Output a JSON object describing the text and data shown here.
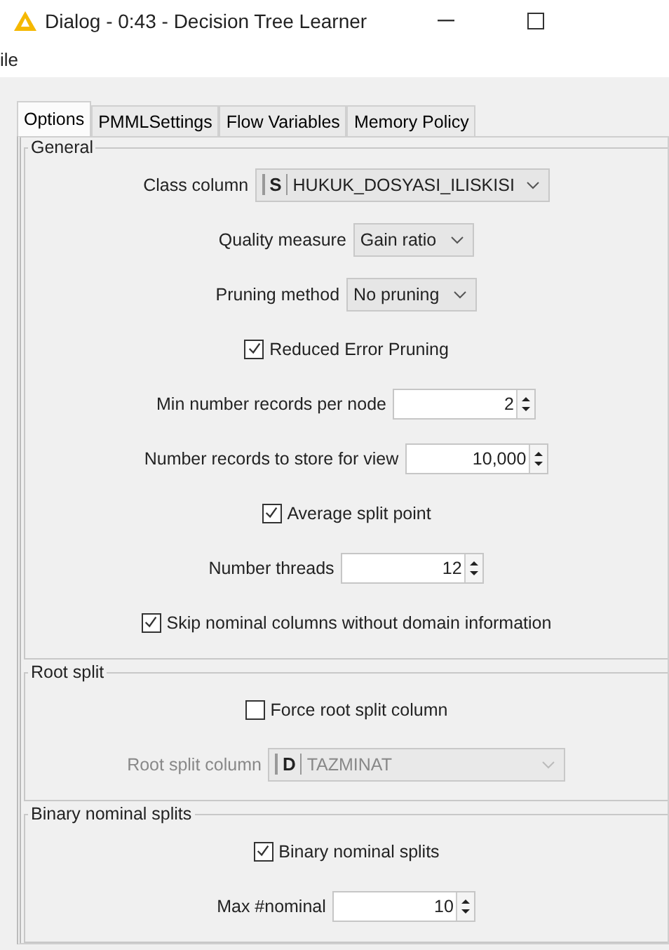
{
  "window": {
    "title": "Dialog - 0:43 - Decision Tree Learner"
  },
  "menu": [
    "ile"
  ],
  "tabs": [
    {
      "label": "Options",
      "selected": true
    },
    {
      "label": "PMMLSettings",
      "selected": false
    },
    {
      "label": "Flow Variables",
      "selected": false
    },
    {
      "label": "Memory Policy",
      "selected": false
    }
  ],
  "sections": [
    {
      "title": "General",
      "rows": [
        {
          "kind": "combo",
          "label": "Class column",
          "type_badge": "S",
          "value": "HUKUK_DOSYASI_ILISKISI",
          "disabled": false
        },
        {
          "kind": "combo",
          "label": "Quality measure",
          "value": "Gain ratio",
          "disabled": false
        },
        {
          "kind": "combo",
          "label": "Pruning method",
          "value": "No pruning",
          "disabled": false
        },
        {
          "kind": "checkbox",
          "label": "Reduced Error Pruning",
          "checked": true
        },
        {
          "kind": "spinner",
          "label": "Min number records per node",
          "value": "2"
        },
        {
          "kind": "spinner",
          "label": "Number records to store for view",
          "value": "10,000"
        },
        {
          "kind": "checkbox",
          "label": "Average split point",
          "checked": true
        },
        {
          "kind": "spinner",
          "label": "Number threads",
          "value": "12"
        },
        {
          "kind": "checkbox",
          "label": "Skip nominal columns without domain information",
          "checked": true
        }
      ]
    },
    {
      "title": "Root split",
      "rows": [
        {
          "kind": "checkbox",
          "label": "Force root split column",
          "checked": false
        },
        {
          "kind": "combo",
          "label": "Root split column",
          "type_badge": "D",
          "value": "TAZMINAT",
          "disabled": true
        }
      ]
    },
    {
      "title": "Binary nominal splits",
      "rows": [
        {
          "kind": "checkbox",
          "label": "Binary nominal splits",
          "checked": true
        },
        {
          "kind": "spinner",
          "label": "Max #nominal",
          "value": "10"
        }
      ]
    }
  ]
}
